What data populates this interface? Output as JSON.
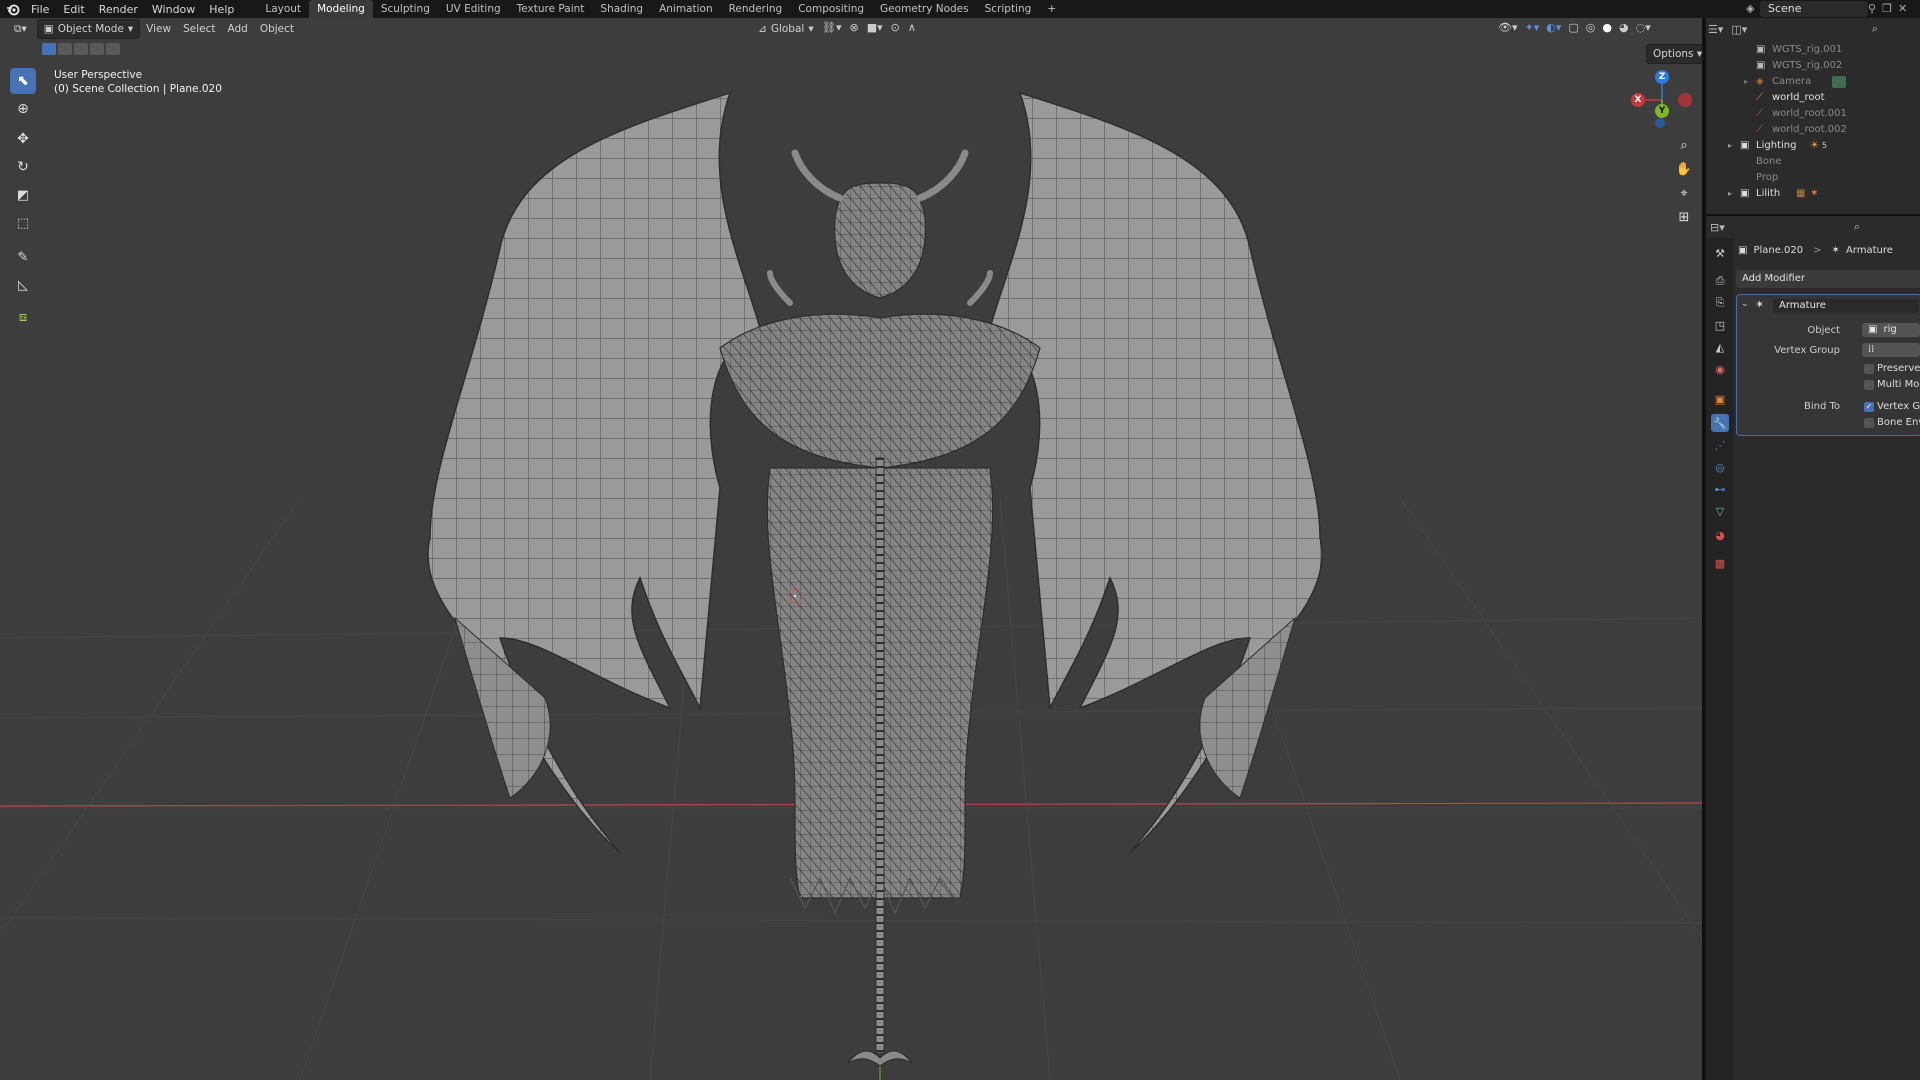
{
  "menubar": {
    "menus": [
      "File",
      "Edit",
      "Render",
      "Window",
      "Help"
    ],
    "workspaces": [
      "Layout",
      "Modeling",
      "Sculpting",
      "UV Editing",
      "Texture Paint",
      "Shading",
      "Animation",
      "Rendering",
      "Compositing",
      "Geometry Nodes",
      "Scripting"
    ],
    "active_workspace": "Modeling",
    "add_tab": "+",
    "scene": "Scene"
  },
  "viewport": {
    "mode": "Object Mode",
    "menus": [
      "View",
      "Select",
      "Add",
      "Object"
    ],
    "orientation": "Global",
    "options": "Options",
    "perspective": "User Perspective",
    "collection_path": "(0) Scene Collection | Plane.020",
    "gizmo": {
      "x": "X",
      "y": "Y",
      "z": "Z"
    }
  },
  "outliner": {
    "rows": [
      {
        "label": "WGTS_rig.001",
        "kind": "collection",
        "dim": true
      },
      {
        "label": "WGTS_rig.002",
        "kind": "collection",
        "dim": true
      },
      {
        "label": "Camera",
        "kind": "camera",
        "dim": true
      },
      {
        "label": "world_root",
        "kind": "bone",
        "dim": false
      },
      {
        "label": "world_root.001",
        "kind": "bone",
        "dim": true
      },
      {
        "label": "world_root.002",
        "kind": "bone",
        "dim": true
      },
      {
        "label": "Lighting",
        "kind": "collection",
        "dim": false,
        "badge": "5"
      },
      {
        "label": "Bone",
        "kind": "plain",
        "dim": true
      },
      {
        "label": "Prop",
        "kind": "plain",
        "dim": true
      },
      {
        "label": "Lilith",
        "kind": "collection",
        "dim": false
      }
    ]
  },
  "properties": {
    "breadcrumb_object": "Plane.020",
    "breadcrumb_sep": ">",
    "breadcrumb_modifier": "Armature",
    "add_modifier": "Add Modifier",
    "modifier_name": "Armature",
    "object_label": "Object",
    "object_value": "rig",
    "vertex_group_label": "Vertex Group",
    "preserve_volume": "Preserve Vo",
    "multi_modifier": "Multi Modif",
    "bind_to_label": "Bind To",
    "bind_vertex_groups": "Vertex Gro",
    "bind_bone_envelopes": "Bone Envel"
  },
  "colors": {
    "accent": "#4772b3",
    "viewport_bg": "#3d3d3d",
    "x_axis": "#c9363f",
    "y_axis": "#7fb622",
    "z_axis": "#2c7be0"
  }
}
